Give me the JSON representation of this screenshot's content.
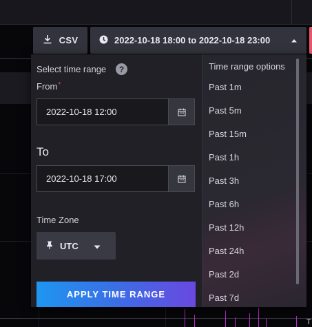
{
  "toolbar": {
    "csv_label": "CSV",
    "range_label": "2022-10-18 18:00 to 2022-10-18 23:00"
  },
  "picker": {
    "title": "Select time range",
    "help": "?",
    "from_label": "From",
    "from_required_mark": "*",
    "from_value": "2022-10-18 12:00",
    "to_heading": "To",
    "to_value": "2022-10-18 17:00",
    "timezone_label": "Time Zone",
    "timezone_value": "UTC",
    "apply_label": "APPLY TIME RANGE"
  },
  "options": {
    "title": "Time range options",
    "items": [
      "Past 1m",
      "Past 5m",
      "Past 15m",
      "Past 1h",
      "Past 3h",
      "Past 6h",
      "Past 12h",
      "Past 24h",
      "Past 2d",
      "Past 7d"
    ]
  },
  "icons": {
    "download": "download-icon",
    "clock": "clock-icon",
    "caret_up": "caret-up-icon",
    "calendar": "calendar-icon",
    "pin": "pin-icon",
    "caret_down": "caret-down-icon"
  },
  "colors": {
    "accent_start": "#1e96f0",
    "accent_end": "#6a48e0",
    "required": "#e0505a",
    "spike": "#c026d3"
  },
  "corner_glyph": "T"
}
